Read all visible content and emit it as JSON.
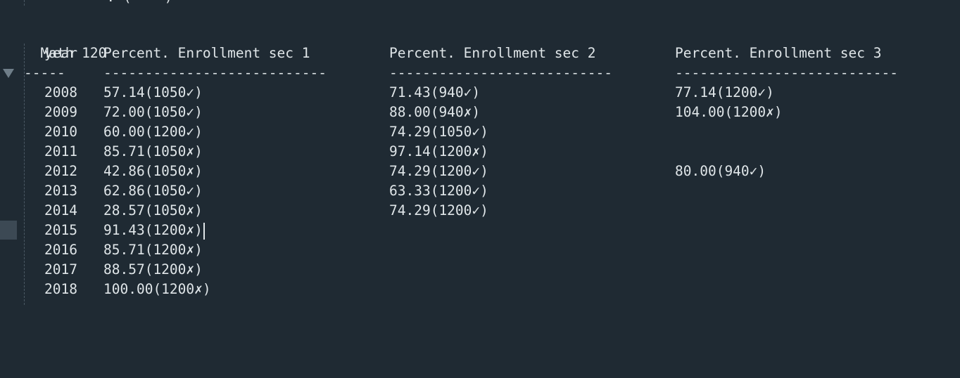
{
  "top_fragment": "– – –  – –.–(––––)",
  "table_title": "Math 120",
  "headers": [
    "year",
    "Percent. Enrollment sec 1",
    "Percent. Enrollment sec 2",
    "Percent. Enrollment sec 3"
  ],
  "separators": [
    "-----",
    "---------------------------",
    "---------------------------",
    "---------------------------"
  ],
  "rows": [
    {
      "year": "2008",
      "sec1": "57.14(1050✓)",
      "sec2": "71.43(940✓)",
      "sec3": "77.14(1200✓)"
    },
    {
      "year": "2009",
      "sec1": "72.00(1050✓)",
      "sec2": "88.00(940✗)",
      "sec3": "104.00(1200✗)"
    },
    {
      "year": "2010",
      "sec1": "60.00(1200✓)",
      "sec2": "74.29(1050✓)",
      "sec3": ""
    },
    {
      "year": "2011",
      "sec1": "85.71(1050✗)",
      "sec2": "97.14(1200✗)",
      "sec3": ""
    },
    {
      "year": "2012",
      "sec1": "42.86(1050✗)",
      "sec2": "74.29(1200✓)",
      "sec3": "80.00(940✓)"
    },
    {
      "year": "2013",
      "sec1": "62.86(1050✓)",
      "sec2": "63.33(1200✓)",
      "sec3": ""
    },
    {
      "year": "2014",
      "sec1": "28.57(1050✗)",
      "sec2": "74.29(1200✓)",
      "sec3": ""
    },
    {
      "year": "2015",
      "sec1": "91.43(1200✗)",
      "sec2": "",
      "sec3": ""
    },
    {
      "year": "2016",
      "sec1": "85.71(1200✗)",
      "sec2": "",
      "sec3": ""
    },
    {
      "year": "2017",
      "sec1": "88.57(1200✗)",
      "sec2": "",
      "sec3": ""
    },
    {
      "year": "2018",
      "sec1": "100.00(1200✗)",
      "sec2": "",
      "sec3": ""
    }
  ]
}
